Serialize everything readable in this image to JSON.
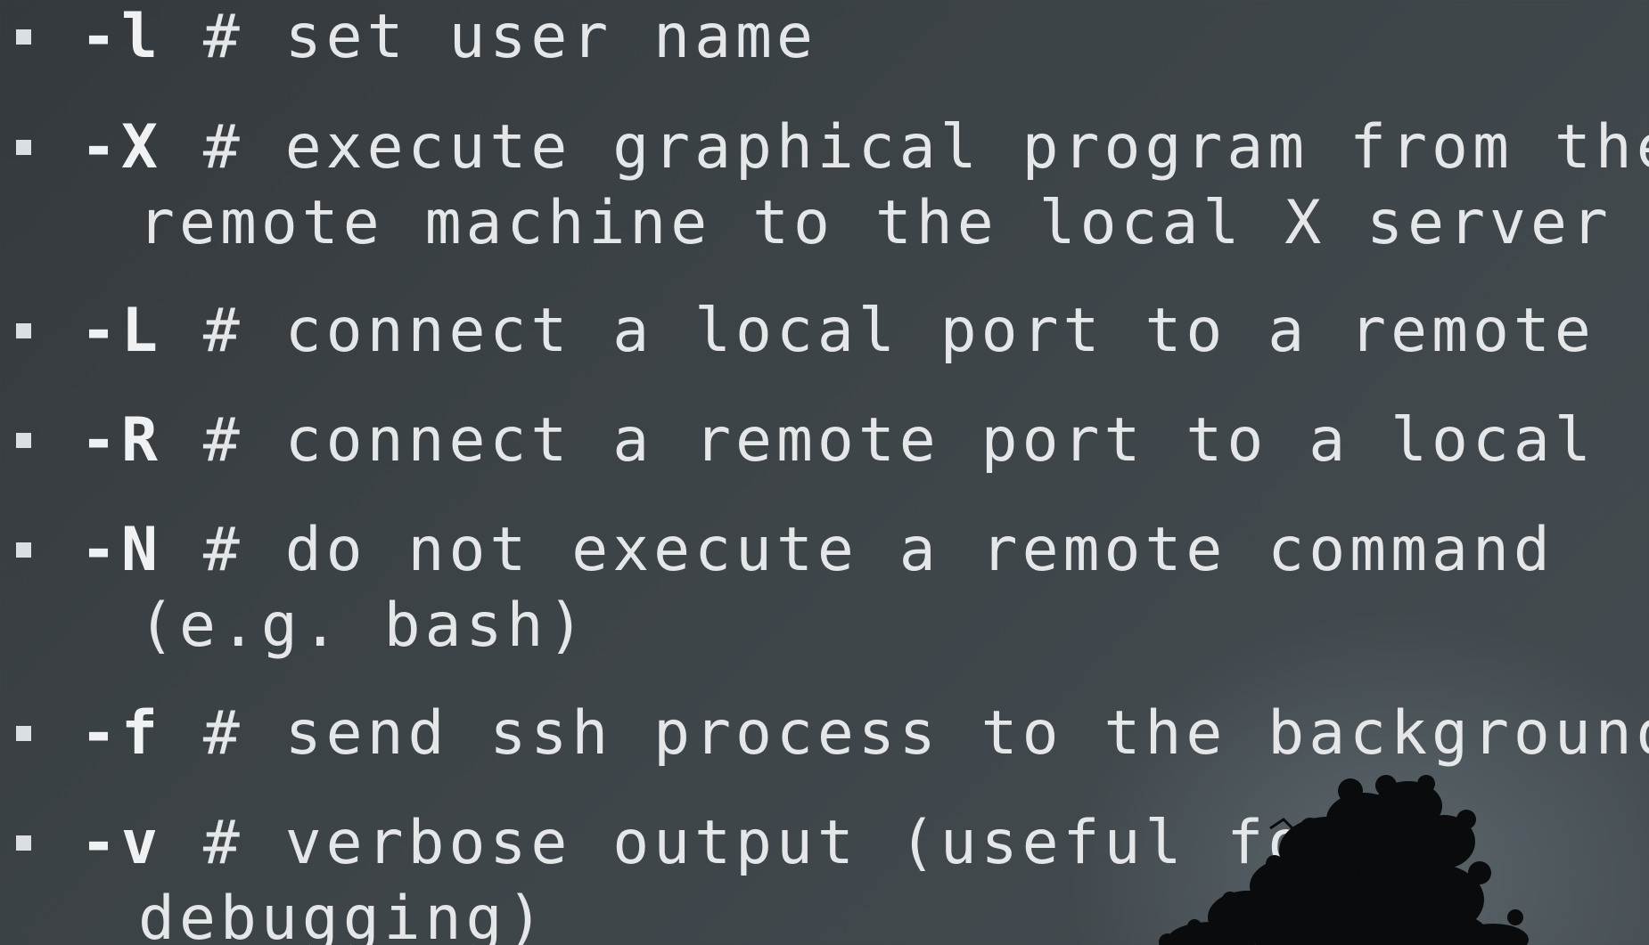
{
  "items": [
    {
      "flag": "-l",
      "text": " # set user name",
      "cont": ""
    },
    {
      "flag": "-X",
      "text": " # execute graphical program from the",
      "cont": "remote machine to the local X server"
    },
    {
      "flag": "-L",
      "text": " # connect a local port to a remote",
      "cont": ""
    },
    {
      "flag": "-R",
      "text": " # connect a remote port to a local",
      "cont": ""
    },
    {
      "flag": "-N",
      "text": " # do not execute a remote command",
      "cont": "(e.g. bash)"
    },
    {
      "flag": "-f",
      "text": " # send ssh process to the background",
      "cont": ""
    },
    {
      "flag": "-v",
      "text": " # verbose output (useful for",
      "cont": "debugging)"
    }
  ],
  "colors": {
    "text": "#e4e6e8",
    "background": "#3d4448",
    "tree": "#0a0b0c"
  },
  "icons": {
    "bullet": "square-bullet-icon",
    "decoration": "tree-silhouette-icon"
  }
}
